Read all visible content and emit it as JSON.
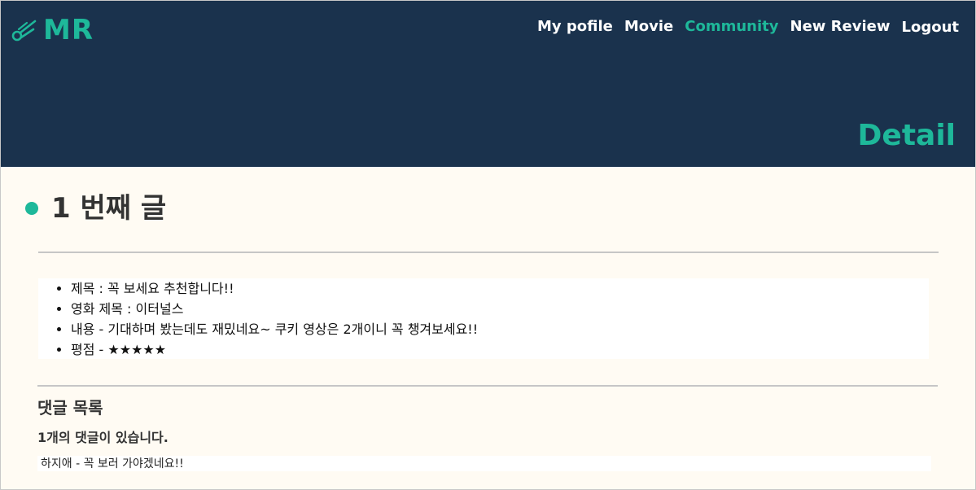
{
  "header": {
    "logo_text": "MR",
    "logo_icon": "comet-icon",
    "title": "Detail",
    "nav": [
      {
        "label": "My pofile",
        "active": false
      },
      {
        "label": "Movie",
        "active": false
      },
      {
        "label": "Community",
        "active": true
      },
      {
        "label": "New Review",
        "active": false
      },
      {
        "label": "Logout",
        "active": false
      }
    ]
  },
  "post": {
    "heading": "1 번째 글",
    "details": [
      "제목 : 꼭 보세요 추천합니다!!",
      "영화 제목 : 이터널스",
      "내용 - 기대하며 봤는데도 재밌네요~ 쿠키 영상은 2개이니 꼭 챙겨보세요!!",
      "평점 - ★★★★★"
    ],
    "rating_stars": 5
  },
  "comments": {
    "title": "댓글 목록",
    "count_text": "1개의 댓글이 있습니다.",
    "items": [
      "하지애 - 꼭 보러 가야겠네요!!"
    ]
  },
  "colors": {
    "header_bg": "#1a324d",
    "accent": "#1eb89a",
    "page_bg": "#fffbf3"
  }
}
